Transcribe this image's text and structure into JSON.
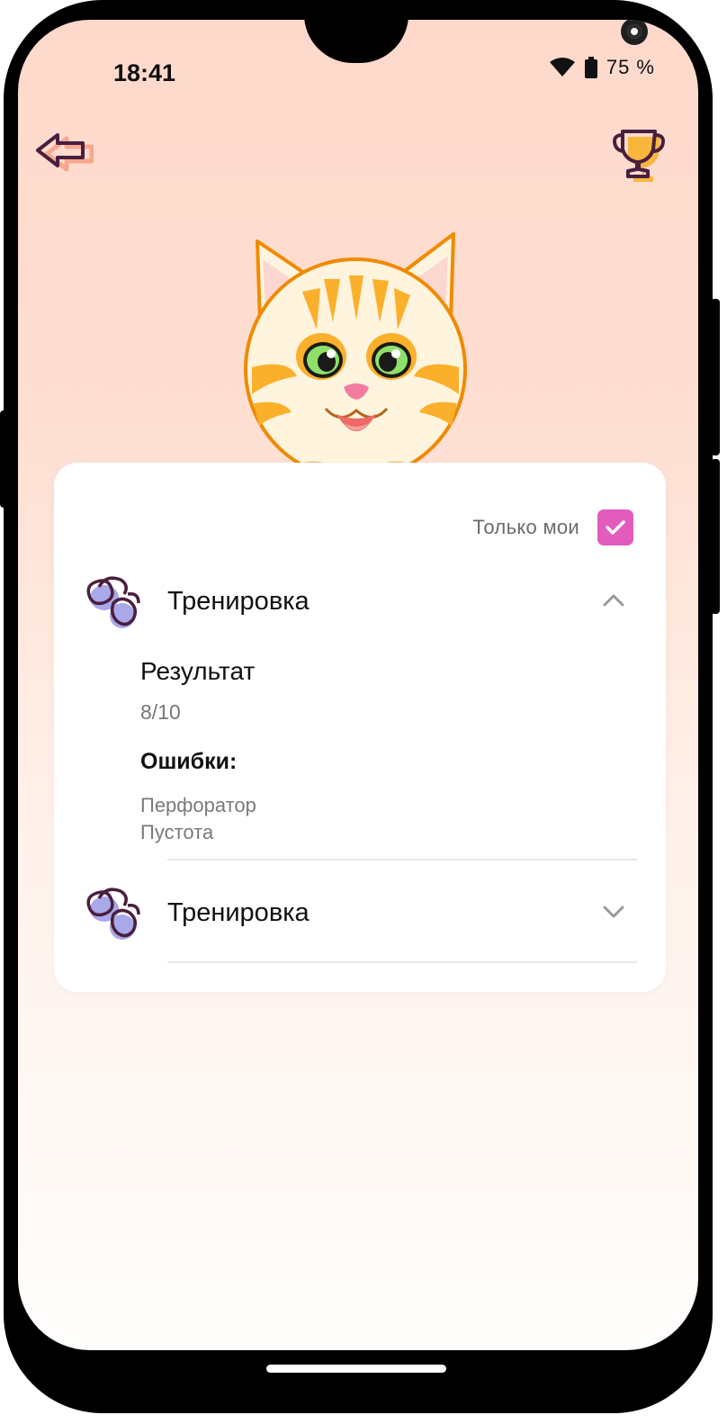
{
  "status_bar": {
    "time": "18:41",
    "battery": "75 %"
  },
  "header": {
    "back_icon": "back-arrow-icon",
    "trophy_icon": "trophy-icon"
  },
  "filter": {
    "label": "Только мои",
    "checked": true
  },
  "items": [
    {
      "title": "Тренировка",
      "icon": "paw-prints-icon",
      "expanded": true,
      "result_label": "Результат",
      "result_value": "8/10",
      "errors_label": "Ошибки:",
      "errors": [
        "Перфоратор",
        "Пустота"
      ]
    },
    {
      "title": "Тренировка",
      "icon": "paw-prints-icon",
      "expanded": false
    }
  ],
  "colors": {
    "accent": "#e25cbd",
    "background_top": "#fed9cb",
    "icon_dark": "#4a1e3e",
    "trophy": "#f8b63c"
  }
}
